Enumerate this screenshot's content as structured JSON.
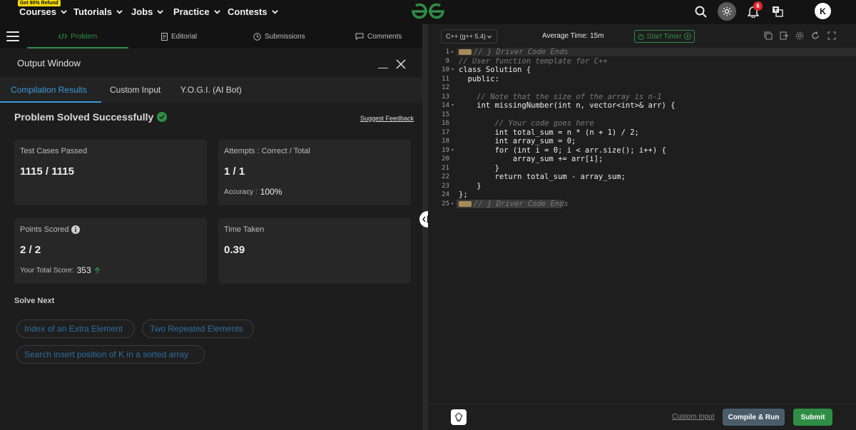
{
  "nav": {
    "refund_badge": "Get 90% Refund",
    "items": [
      "Courses",
      "Tutorials",
      "Jobs",
      "Practice",
      "Contests"
    ],
    "notification_count": "6",
    "avatar_letter": "K"
  },
  "problem_tabs": [
    "Problem",
    "Editorial",
    "Submissions",
    "Comments"
  ],
  "output": {
    "title": "Output Window",
    "subtabs": [
      "Compilation Results",
      "Custom Input",
      "Y.O.G.I. (AI Bot)"
    ],
    "status": "Problem Solved Successfully",
    "feedback_link": "Suggest Feedback",
    "cards": {
      "test_cases_label": "Test Cases Passed",
      "test_cases_value": "1115 / 1115",
      "attempts_label": "Attempts : Correct / Total",
      "attempts_value": "1 / 1",
      "accuracy_label": "Accuracy :",
      "accuracy_value": "100%",
      "points_label": "Points Scored",
      "points_value": "2 / 2",
      "total_score_label": "Your Total Score:",
      "total_score_value": "353",
      "time_label": "Time Taken",
      "time_value": "0.39"
    },
    "solve_next_label": "Solve Next",
    "solve_next": [
      "Index of an Extra Element",
      "Two Repeated Elements",
      "Search insert position of K in a sorted array"
    ]
  },
  "editor": {
    "language": "C++ (g++ 5.4)",
    "avg_time": "Average Time: 15m",
    "timer_label": "Start Timer",
    "lines": [
      {
        "n": "1",
        "text": "// } Driver Code Ends",
        "type": "comment",
        "fold": "▸",
        "tag": true
      },
      {
        "n": "9",
        "text": "// User function template for C++",
        "type": "comment"
      },
      {
        "n": "10",
        "text": "class Solution {",
        "type": "code",
        "fold": "▾"
      },
      {
        "n": "11",
        "text": "  public:",
        "type": "code"
      },
      {
        "n": "12",
        "text": "",
        "type": "code"
      },
      {
        "n": "13",
        "text": "    // Note that the size of the array is n-1",
        "type": "comment"
      },
      {
        "n": "14",
        "text": "    int missingNumber(int n, vector<int>& arr) {",
        "type": "code",
        "fold": "▾"
      },
      {
        "n": "15",
        "text": "",
        "type": "code"
      },
      {
        "n": "16",
        "text": "        // Your code goes here",
        "type": "comment"
      },
      {
        "n": "17",
        "text": "        int total_sum = n * (n + 1) / 2;",
        "type": "code"
      },
      {
        "n": "18",
        "text": "        int array_sum = 0;",
        "type": "code"
      },
      {
        "n": "19",
        "text": "        for (int i = 0; i < arr.size(); i++) {",
        "type": "code",
        "fold": "▾"
      },
      {
        "n": "20",
        "text": "            array_sum += arr[i];",
        "type": "code"
      },
      {
        "n": "21",
        "text": "        }",
        "type": "code"
      },
      {
        "n": "22",
        "text": "        return total_sum - array_sum;",
        "type": "code"
      },
      {
        "n": "23",
        "text": "    }",
        "type": "code"
      },
      {
        "n": "24",
        "text": "};",
        "type": "code"
      },
      {
        "n": "25",
        "text": "// } Driver Code Ends",
        "type": "comment",
        "fold": "▸",
        "tag": true
      }
    ],
    "custom_input": "Custom Input",
    "compile_label": "Compile & Run",
    "submit_label": "Submit"
  },
  "colors": {
    "brand_green": "#2f8d46",
    "link_blue": "#3a9bd8"
  }
}
